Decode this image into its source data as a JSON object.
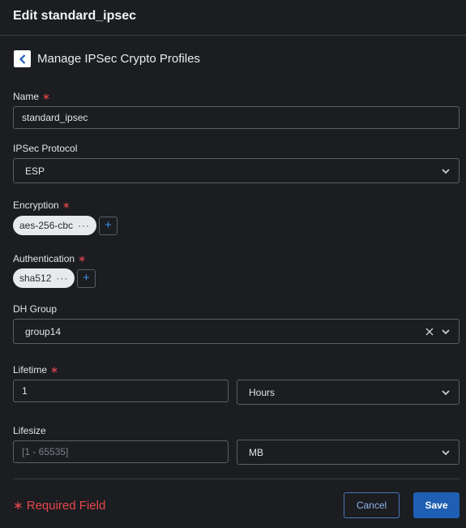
{
  "header": {
    "title": "Edit standard_ipsec"
  },
  "section": {
    "title": "Manage IPSec Crypto Profiles"
  },
  "form": {
    "required_mark": "∗",
    "name": {
      "label": "Name",
      "value": "standard_ipsec"
    },
    "ipsec_protocol": {
      "label": "IPSec Protocol",
      "value": "ESP"
    },
    "encryption": {
      "label": "Encryption",
      "chip": "aes-256-cbc",
      "more": "···",
      "add": "+"
    },
    "authentication": {
      "label": "Authentication",
      "chip": "sha512",
      "more": "···",
      "add": "+"
    },
    "dh_group": {
      "label": "DH Group",
      "value": "group14"
    },
    "lifetime": {
      "label": "Lifetime",
      "value": "1",
      "unit": "Hours"
    },
    "lifesize": {
      "label": "Lifesize",
      "placeholder": "[1 - 65535]",
      "unit": "MB"
    }
  },
  "footer": {
    "required_note": "∗ Required Field",
    "cancel_label": "Cancel",
    "save_label": "Save"
  },
  "colors": {
    "accent": "#1e5fb3",
    "required": "#e5484d",
    "background": "#1b1d21"
  }
}
